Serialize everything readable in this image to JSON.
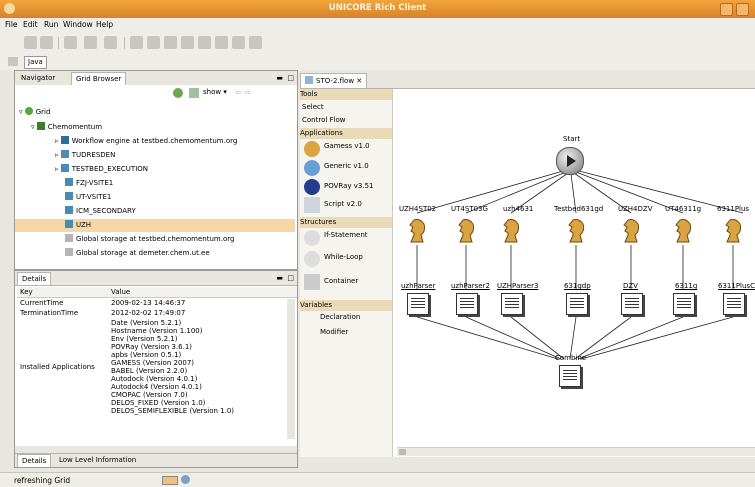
{
  "window": {
    "title": "UNICORE Rich Client"
  },
  "menu": [
    "File",
    "Edit",
    "Run",
    "Window",
    "Help"
  ],
  "perspective": {
    "label": "Java"
  },
  "left_top": {
    "tabs": [
      "Navigator",
      "Grid Browser"
    ],
    "toolbar_show": "show",
    "tree": [
      {
        "label": "Grid",
        "level": 0
      },
      {
        "label": "Chemomentum",
        "level": 1
      },
      {
        "label": "Workflow engine at testbed.chemomentum.org",
        "level": 2
      },
      {
        "label": "TUDRESDEN",
        "level": 2
      },
      {
        "label": "TESTBED_EXECUTION",
        "level": 2
      },
      {
        "label": "FZJ-VSITE1",
        "level": 2
      },
      {
        "label": "UT-VSITE1",
        "level": 2
      },
      {
        "label": "ICM_SECONDARY",
        "level": 2
      },
      {
        "label": "UZH",
        "level": 2
      },
      {
        "label": "Global storage at testbed.chemomentum.org",
        "level": 2
      },
      {
        "label": "Global storage at demeter.chem.ut.ee",
        "level": 2
      }
    ]
  },
  "details": {
    "tab": "Details",
    "col_key": "Key",
    "col_value": "Value",
    "rows": [
      {
        "key": "CurrentTime",
        "value": "2009-02-13 14:46:37"
      },
      {
        "key": "TerminationTime",
        "value": "2012-02-02 17:49:07"
      }
    ],
    "apps_key": "Installed Applications",
    "apps": [
      "Date (Version 5.2.1)",
      "Hostname (Version 1.100)",
      "Env (Version 5.2.1)",
      "POVRay (Version 3.6.1)",
      "apbs (Version 0.5.1)",
      "GAMESS (Version 2007)",
      "BABEL (Version 2.2.0)",
      "Autodock (Version 4.0.1)",
      "Autodock4 (Version 4.0.1)",
      "CMOPAC (Version 7.0)",
      "DELOS_FIXED (Version 1.0)",
      "DELOS_SEMIFLEXIBLE (Version 1.0)"
    ],
    "bottom_tabs": [
      "Details",
      "Low Level Information"
    ]
  },
  "editor": {
    "tab": "STO-2.flow",
    "palette": {
      "tools_header": "Tools",
      "select": "Select",
      "control_flow": "Control Flow",
      "applications_header": "Applications",
      "applications": [
        "Gamess v1.0",
        "Generic v1.0",
        "POVRay v3.51",
        "Script v2.0"
      ],
      "structures_header": "Structures",
      "structures": [
        "If-Statement",
        "While-Loop",
        "Container"
      ],
      "variables_header": "Variables",
      "variables": [
        "Declaration",
        "Modifier"
      ]
    },
    "start_label": "Start",
    "jobs": [
      "UZH4ST02",
      "UT4ST03G",
      "uzh4631",
      "Testbed631gd",
      "UZH4DZV",
      "UT46311g",
      "6311Plus"
    ],
    "outputs": [
      "uzhParser",
      "uzhParser2",
      "UZHParser3",
      "631gdp",
      "DZV",
      "6311g",
      "6311PlusC"
    ],
    "combine_label": "Combine"
  },
  "status": {
    "text": "refreshing Grid"
  },
  "colors": {
    "title_bar": "#e4922f",
    "selection": "#f6d8a8",
    "accent": "#e0a24a"
  }
}
